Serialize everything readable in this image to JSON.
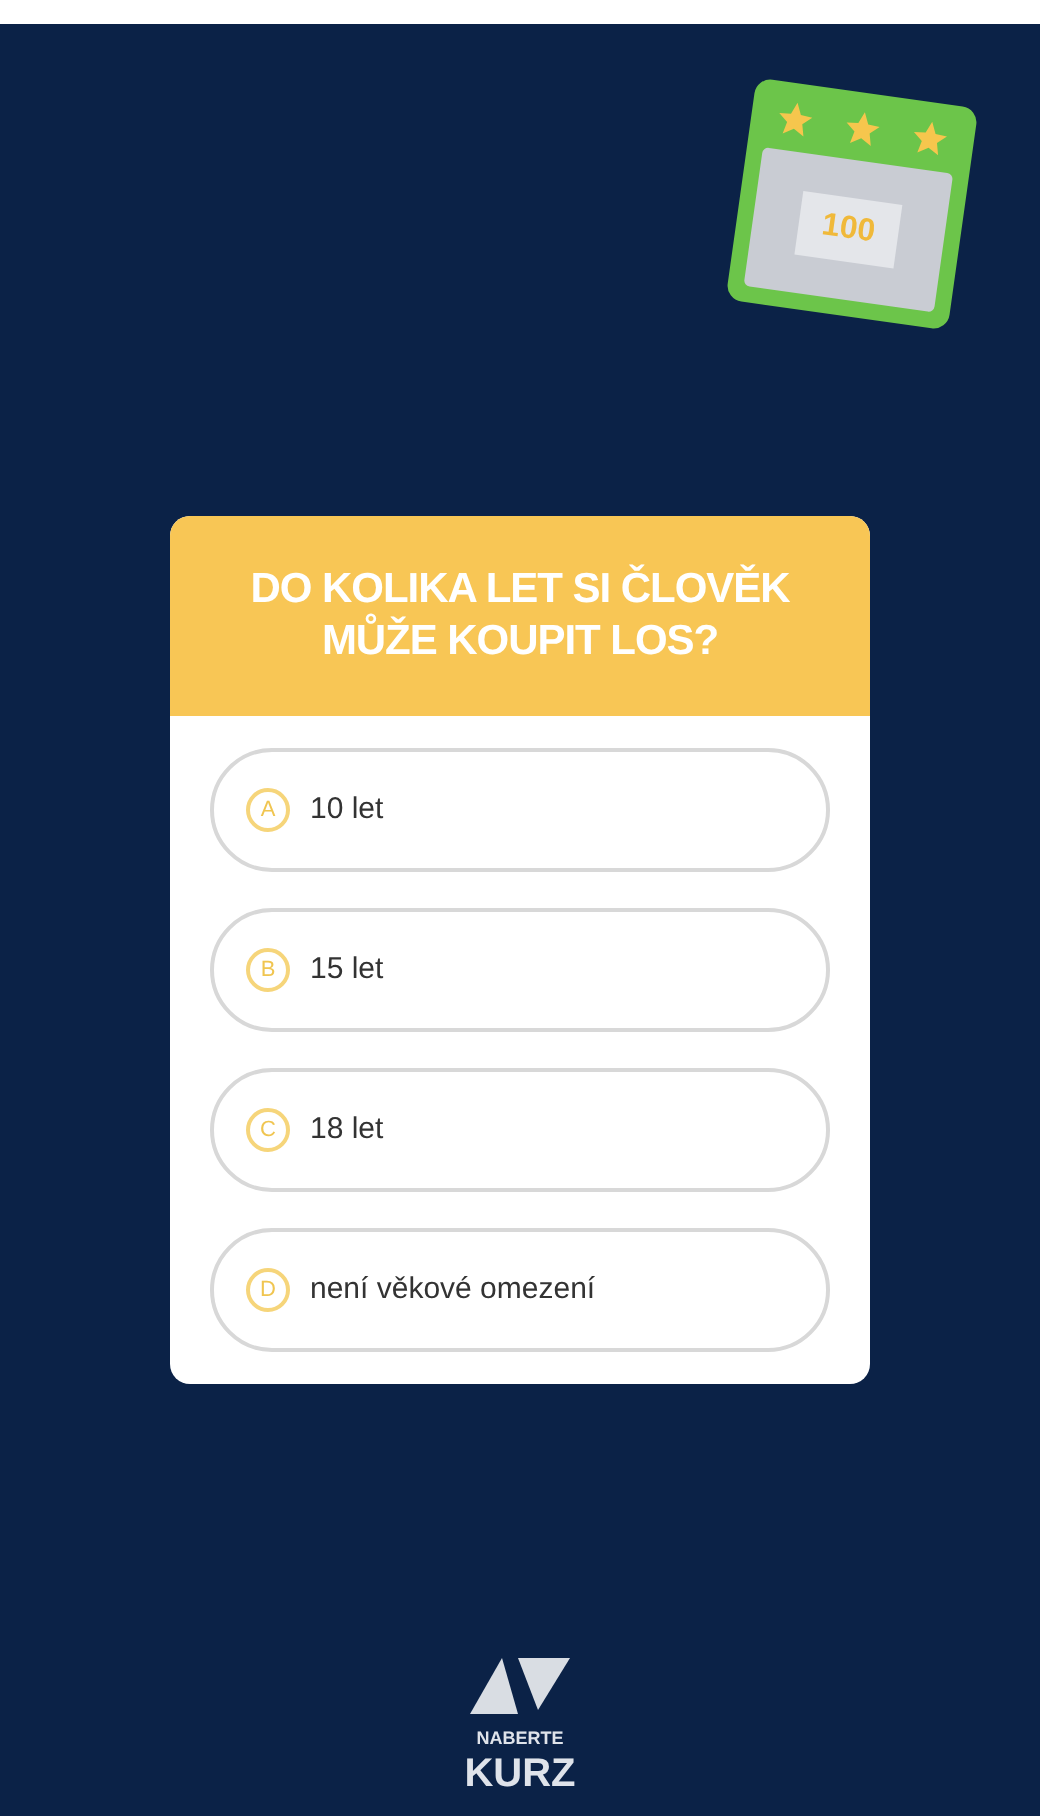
{
  "ticket": {
    "value": "100"
  },
  "question": "DO KOLIKA LET SI ČLOVĚK MŮŽE KOUPIT LOS?",
  "options": [
    {
      "letter": "A",
      "text": "10 let"
    },
    {
      "letter": "B",
      "text": "15 let"
    },
    {
      "letter": "C",
      "text": "18 let"
    },
    {
      "letter": "D",
      "text": "není věkové omezení"
    }
  ],
  "logo": {
    "line_1": "NABERTE",
    "line_2": "KURZ"
  }
}
